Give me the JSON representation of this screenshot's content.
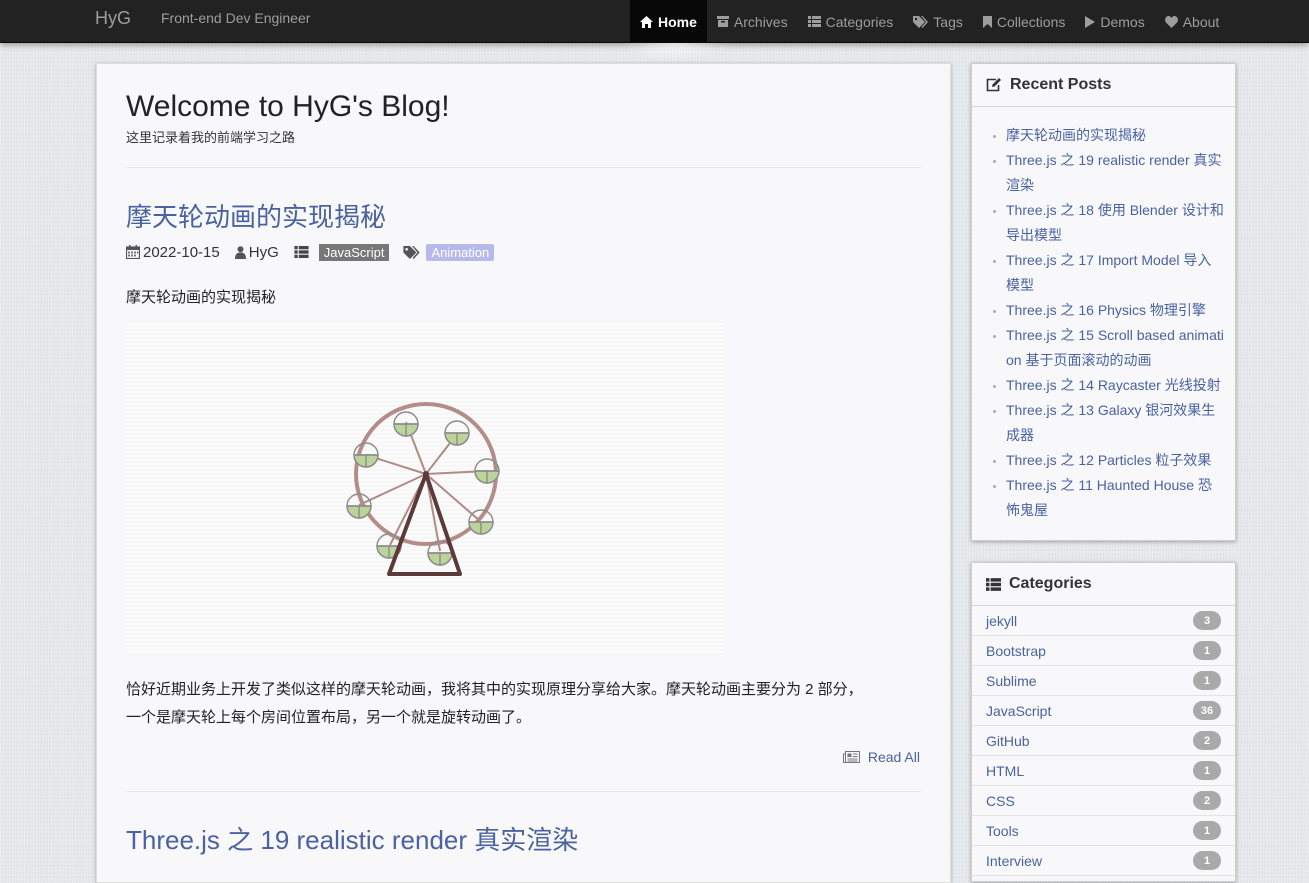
{
  "navbar": {
    "brand": "HyG",
    "tagline": "Front-end Dev Engineer",
    "items": [
      {
        "label": "Home",
        "icon": "home-icon",
        "active": true
      },
      {
        "label": "Archives",
        "icon": "archive-icon"
      },
      {
        "label": "Categories",
        "icon": "list-icon"
      },
      {
        "label": "Tags",
        "icon": "tags-icon"
      },
      {
        "label": "Collections",
        "icon": "bookmark-icon"
      },
      {
        "label": "Demos",
        "icon": "play-icon"
      },
      {
        "label": "About",
        "icon": "heart-icon"
      }
    ]
  },
  "main": {
    "title": "Welcome to HyG's Blog!",
    "subtitle": "这里记录着我的前端学习之路",
    "post": {
      "title": "摩天轮动画的实现揭秘",
      "date": "2022-10-15",
      "author": "HyG",
      "category": "JavaScript",
      "tag": "Animation",
      "excerpt": "摩天轮动画的实现揭秘",
      "body_line1": "恰好近期业务上开发了类似这样的摩天轮动画，我将其中的实现原理分享给大家。摩天轮动画主要分为 2 部分，",
      "body_line2": "一个是摩天轮上每个房间位置布局，另一个就是旋转动画了。",
      "read_all": "Read All"
    },
    "next_post_title": "Three.js 之 19 realistic render 真实渲染"
  },
  "sidebar": {
    "recent": {
      "title": "Recent Posts",
      "items": [
        "摩天轮动画的实现揭秘",
        "Three.js 之 19 realistic render 真实渲染",
        "Three.js 之 18 使用 Blender 设计和导出模型",
        "Three.js 之 17 Import Model 导入模型",
        "Three.js 之 16 Physics 物理引擎",
        "Three.js 之 15 Scroll based animation 基于页面滚动的动画",
        "Three.js 之 14 Raycaster 光线投射",
        "Three.js 之 13 Galaxy 银河效果生成器",
        "Three.js 之 12 Particles 粒子效果",
        "Three.js 之 11 Haunted House 恐怖鬼屋"
      ]
    },
    "categories": {
      "title": "Categories",
      "items": [
        {
          "name": "jekyll",
          "count": "3"
        },
        {
          "name": "Bootstrap",
          "count": "1"
        },
        {
          "name": "Sublime",
          "count": "1"
        },
        {
          "name": "JavaScript",
          "count": "36"
        },
        {
          "name": "GitHub",
          "count": "2"
        },
        {
          "name": "HTML",
          "count": "1"
        },
        {
          "name": "CSS",
          "count": "2"
        },
        {
          "name": "Tools",
          "count": "1"
        },
        {
          "name": "Interview",
          "count": "1"
        }
      ]
    }
  }
}
